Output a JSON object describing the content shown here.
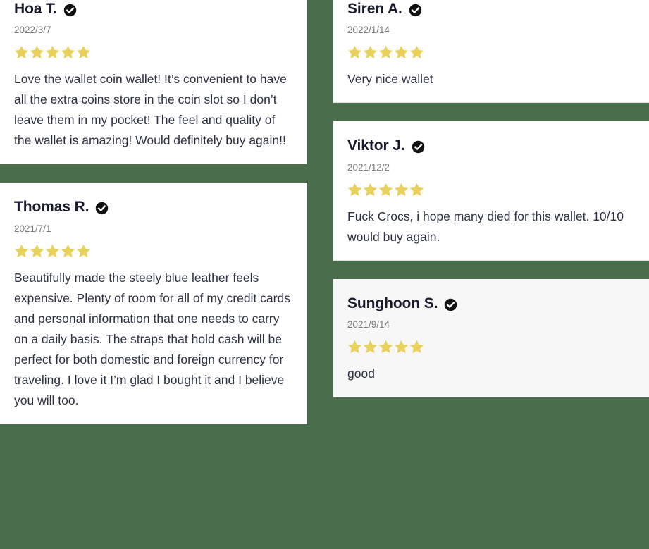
{
  "theme": {
    "page_background": "#4a6e4b",
    "card_background": "#ffffff",
    "card_background_tinted": "#f7f7f7",
    "star_color": "#e8d15c",
    "badge_color": "#111111",
    "name_color": "#1b1b2f",
    "date_color": "#7b7b7b",
    "body_color": "#2e3142",
    "divider_color": "#e4e4e4"
  },
  "icons": {
    "verified": "verified-check-icon",
    "star": "star-icon"
  },
  "columns": {
    "left": [
      {
        "name": "Hoa T.",
        "verified": true,
        "date": "2022/3/7",
        "stars": 5,
        "body": "Love the wallet coin wallet! It’s convenient to have all the extra coins store in the coin slot so I don’t leave them in my pocket! The feel and quality of the wallet is amazing! Would definitely buy again!!",
        "tinted": false,
        "clipped_top": true
      },
      {
        "name": "Thomas R.",
        "verified": true,
        "date": "2021/7/1",
        "stars": 5,
        "body": "Beautifully made the steely blue leather feels expensive. Plenty of room for all of my credit cards and personal information that one needs to carry on a daily basis. The straps that hold cash will be perfect for both domestic and foreign currency for traveling. I love it I’m glad I bought it and I believe you will too.",
        "tinted": false,
        "clipped_top": false
      }
    ],
    "right": [
      {
        "name": "Siren A.",
        "verified": true,
        "date": "2022/1/14",
        "stars": 5,
        "body": "Very nice wallet",
        "tinted": false,
        "clipped_top": true
      },
      {
        "name": "Viktor J.",
        "verified": true,
        "date": "2021/12/2",
        "stars": 5,
        "body": "Fuck Crocs, i hope many died for this wallet. 10/10 would buy again.",
        "tinted": false,
        "clipped_top": false
      },
      {
        "name": "Sunghoon S.",
        "verified": true,
        "date": "2021/9/14",
        "stars": 5,
        "body": "good",
        "tinted": true,
        "clipped_top": false
      }
    ]
  }
}
